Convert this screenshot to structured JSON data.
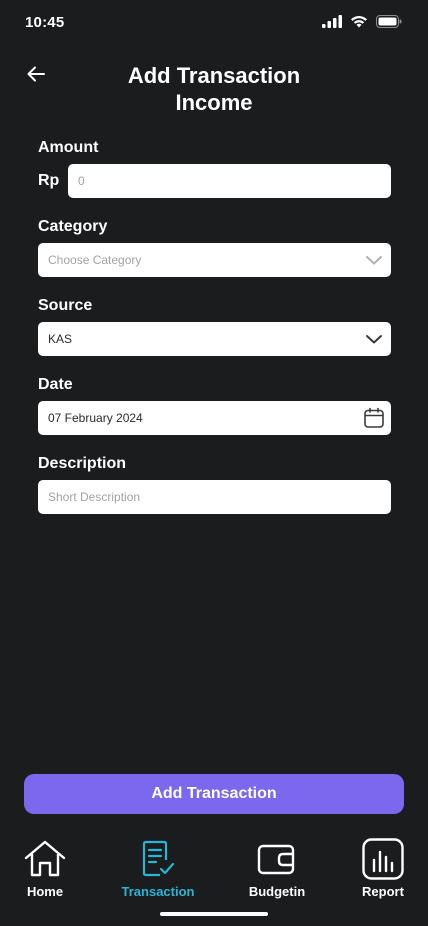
{
  "status": {
    "time": "10:45"
  },
  "header": {
    "title_line1": "Add Transaction",
    "title_line2": "Income"
  },
  "form": {
    "amount": {
      "label": "Amount",
      "currency": "Rp",
      "placeholder": "0"
    },
    "category": {
      "label": "Category",
      "placeholder": "Choose Category"
    },
    "source": {
      "label": "Source",
      "value": "KAS"
    },
    "date": {
      "label": "Date",
      "value": "07 February 2024"
    },
    "description": {
      "label": "Description",
      "placeholder": "Short Description"
    }
  },
  "submit_label": "Add Transaction",
  "nav": {
    "items": [
      {
        "label": "Home",
        "icon": "home-icon"
      },
      {
        "label": "Transaction",
        "icon": "transaction-icon"
      },
      {
        "label": "Budgetin",
        "icon": "wallet-icon"
      },
      {
        "label": "Report",
        "icon": "report-icon"
      }
    ],
    "active_index": 1,
    "active_color": "#29b6d6"
  },
  "colors": {
    "background": "#1b1c1e",
    "accent": "#7b68ee"
  }
}
